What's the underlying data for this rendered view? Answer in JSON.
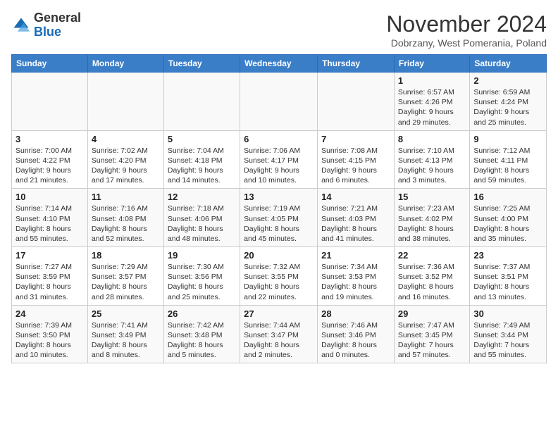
{
  "logo": {
    "general": "General",
    "blue": "Blue"
  },
  "header": {
    "month": "November 2024",
    "location": "Dobrzany, West Pomerania, Poland"
  },
  "days_of_week": [
    "Sunday",
    "Monday",
    "Tuesday",
    "Wednesday",
    "Thursday",
    "Friday",
    "Saturday"
  ],
  "weeks": [
    [
      {
        "day": "",
        "info": ""
      },
      {
        "day": "",
        "info": ""
      },
      {
        "day": "",
        "info": ""
      },
      {
        "day": "",
        "info": ""
      },
      {
        "day": "",
        "info": ""
      },
      {
        "day": "1",
        "info": "Sunrise: 6:57 AM\nSunset: 4:26 PM\nDaylight: 9 hours and 29 minutes."
      },
      {
        "day": "2",
        "info": "Sunrise: 6:59 AM\nSunset: 4:24 PM\nDaylight: 9 hours and 25 minutes."
      }
    ],
    [
      {
        "day": "3",
        "info": "Sunrise: 7:00 AM\nSunset: 4:22 PM\nDaylight: 9 hours and 21 minutes."
      },
      {
        "day": "4",
        "info": "Sunrise: 7:02 AM\nSunset: 4:20 PM\nDaylight: 9 hours and 17 minutes."
      },
      {
        "day": "5",
        "info": "Sunrise: 7:04 AM\nSunset: 4:18 PM\nDaylight: 9 hours and 14 minutes."
      },
      {
        "day": "6",
        "info": "Sunrise: 7:06 AM\nSunset: 4:17 PM\nDaylight: 9 hours and 10 minutes."
      },
      {
        "day": "7",
        "info": "Sunrise: 7:08 AM\nSunset: 4:15 PM\nDaylight: 9 hours and 6 minutes."
      },
      {
        "day": "8",
        "info": "Sunrise: 7:10 AM\nSunset: 4:13 PM\nDaylight: 9 hours and 3 minutes."
      },
      {
        "day": "9",
        "info": "Sunrise: 7:12 AM\nSunset: 4:11 PM\nDaylight: 8 hours and 59 minutes."
      }
    ],
    [
      {
        "day": "10",
        "info": "Sunrise: 7:14 AM\nSunset: 4:10 PM\nDaylight: 8 hours and 55 minutes."
      },
      {
        "day": "11",
        "info": "Sunrise: 7:16 AM\nSunset: 4:08 PM\nDaylight: 8 hours and 52 minutes."
      },
      {
        "day": "12",
        "info": "Sunrise: 7:18 AM\nSunset: 4:06 PM\nDaylight: 8 hours and 48 minutes."
      },
      {
        "day": "13",
        "info": "Sunrise: 7:19 AM\nSunset: 4:05 PM\nDaylight: 8 hours and 45 minutes."
      },
      {
        "day": "14",
        "info": "Sunrise: 7:21 AM\nSunset: 4:03 PM\nDaylight: 8 hours and 41 minutes."
      },
      {
        "day": "15",
        "info": "Sunrise: 7:23 AM\nSunset: 4:02 PM\nDaylight: 8 hours and 38 minutes."
      },
      {
        "day": "16",
        "info": "Sunrise: 7:25 AM\nSunset: 4:00 PM\nDaylight: 8 hours and 35 minutes."
      }
    ],
    [
      {
        "day": "17",
        "info": "Sunrise: 7:27 AM\nSunset: 3:59 PM\nDaylight: 8 hours and 31 minutes."
      },
      {
        "day": "18",
        "info": "Sunrise: 7:29 AM\nSunset: 3:57 PM\nDaylight: 8 hours and 28 minutes."
      },
      {
        "day": "19",
        "info": "Sunrise: 7:30 AM\nSunset: 3:56 PM\nDaylight: 8 hours and 25 minutes."
      },
      {
        "day": "20",
        "info": "Sunrise: 7:32 AM\nSunset: 3:55 PM\nDaylight: 8 hours and 22 minutes."
      },
      {
        "day": "21",
        "info": "Sunrise: 7:34 AM\nSunset: 3:53 PM\nDaylight: 8 hours and 19 minutes."
      },
      {
        "day": "22",
        "info": "Sunrise: 7:36 AM\nSunset: 3:52 PM\nDaylight: 8 hours and 16 minutes."
      },
      {
        "day": "23",
        "info": "Sunrise: 7:37 AM\nSunset: 3:51 PM\nDaylight: 8 hours and 13 minutes."
      }
    ],
    [
      {
        "day": "24",
        "info": "Sunrise: 7:39 AM\nSunset: 3:50 PM\nDaylight: 8 hours and 10 minutes."
      },
      {
        "day": "25",
        "info": "Sunrise: 7:41 AM\nSunset: 3:49 PM\nDaylight: 8 hours and 8 minutes."
      },
      {
        "day": "26",
        "info": "Sunrise: 7:42 AM\nSunset: 3:48 PM\nDaylight: 8 hours and 5 minutes."
      },
      {
        "day": "27",
        "info": "Sunrise: 7:44 AM\nSunset: 3:47 PM\nDaylight: 8 hours and 2 minutes."
      },
      {
        "day": "28",
        "info": "Sunrise: 7:46 AM\nSunset: 3:46 PM\nDaylight: 8 hours and 0 minutes."
      },
      {
        "day": "29",
        "info": "Sunrise: 7:47 AM\nSunset: 3:45 PM\nDaylight: 7 hours and 57 minutes."
      },
      {
        "day": "30",
        "info": "Sunrise: 7:49 AM\nSunset: 3:44 PM\nDaylight: 7 hours and 55 minutes."
      }
    ]
  ]
}
